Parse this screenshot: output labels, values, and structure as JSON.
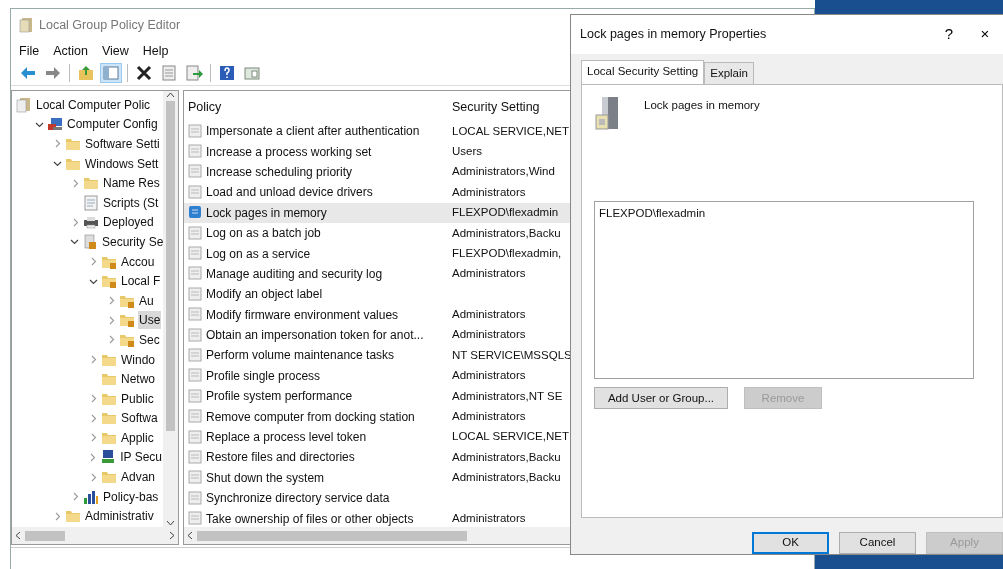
{
  "window": {
    "title": "Local Group Policy Editor"
  },
  "menu": [
    "File",
    "Action",
    "View",
    "Help"
  ],
  "toolbar": [
    {
      "kind": "back",
      "pressed": false
    },
    {
      "kind": "forward",
      "pressed": false
    },
    {
      "kind": "up",
      "pressed": false
    },
    {
      "kind": "tree",
      "pressed": true
    },
    {
      "kind": "delete",
      "pressed": false
    },
    {
      "kind": "properties",
      "pressed": false
    },
    {
      "kind": "export",
      "pressed": false
    },
    {
      "kind": "help",
      "pressed": false
    },
    {
      "kind": "view",
      "pressed": false
    }
  ],
  "tree": [
    {
      "label": "Local Computer Polic",
      "kind": "policy",
      "selected": false,
      "children": [
        {
          "label": "Computer Config",
          "kind": "computer",
          "expanded": true,
          "selected": false,
          "children": [
            {
              "label": "Software Setti",
              "kind": "folder",
              "expanded": false,
              "selected": false
            },
            {
              "label": "Windows Sett",
              "kind": "folder",
              "expanded": true,
              "selected": false,
              "children": [
                {
                  "label": "Name Res",
                  "kind": "folder",
                  "expanded": false,
                  "selected": false
                },
                {
                  "label": "Scripts (St",
                  "kind": "script",
                  "selected": false
                },
                {
                  "label": "Deployed",
                  "kind": "printer",
                  "expanded": false,
                  "selected": false
                },
                {
                  "label": "Security Se",
                  "kind": "security",
                  "expanded": true,
                  "selected": false,
                  "children": [
                    {
                      "label": "Accou",
                      "kind": "lockfolder",
                      "expanded": false,
                      "selected": false
                    },
                    {
                      "label": "Local F",
                      "kind": "lockfolder",
                      "expanded": true,
                      "selected": false,
                      "children": [
                        {
                          "label": "Au",
                          "kind": "lockfolder",
                          "expanded": false,
                          "selected": false
                        },
                        {
                          "label": "Use",
                          "kind": "lockfolder",
                          "expanded": false,
                          "selected": true
                        },
                        {
                          "label": "Sec",
                          "kind": "lockfolder",
                          "expanded": false,
                          "selected": false
                        }
                      ]
                    },
                    {
                      "label": "Windo",
                      "kind": "folder",
                      "expanded": false,
                      "selected": false
                    },
                    {
                      "label": "Netwo",
                      "kind": "folder",
                      "selected": false
                    },
                    {
                      "label": "Public",
                      "kind": "folder",
                      "expanded": false,
                      "selected": false
                    },
                    {
                      "label": "Softwa",
                      "kind": "folder",
                      "expanded": false,
                      "selected": false
                    },
                    {
                      "label": "Applic",
                      "kind": "folder",
                      "expanded": false,
                      "selected": false
                    },
                    {
                      "label": "IP Secu",
                      "kind": "network",
                      "expanded": false,
                      "selected": false
                    },
                    {
                      "label": "Advan",
                      "kind": "folder",
                      "expanded": false,
                      "selected": false
                    }
                  ]
                },
                {
                  "label": "Policy-bas",
                  "kind": "chart",
                  "expanded": false,
                  "selected": false
                }
              ]
            },
            {
              "label": "Administrativ",
              "kind": "folder",
              "expanded": false,
              "selected": false
            }
          ]
        }
      ]
    }
  ],
  "table": {
    "columns": [
      "Policy",
      "Security Setting"
    ],
    "rows": [
      {
        "policy": "Impersonate a client after authentication",
        "setting": "LOCAL SERVICE,NET",
        "selected": false
      },
      {
        "policy": "Increase a process working set",
        "setting": "Users",
        "selected": false
      },
      {
        "policy": "Increase scheduling priority",
        "setting": "Administrators,Wind",
        "selected": false
      },
      {
        "policy": "Load and unload device drivers",
        "setting": "Administrators",
        "selected": false
      },
      {
        "policy": "Lock pages in memory",
        "setting": "FLEXPOD\\flexadmin",
        "selected": true
      },
      {
        "policy": "Log on as a batch job",
        "setting": "Administrators,Backu",
        "selected": false
      },
      {
        "policy": "Log on as a service",
        "setting": "FLEXPOD\\flexadmin,",
        "selected": false
      },
      {
        "policy": "Manage auditing and security log",
        "setting": "Administrators",
        "selected": false
      },
      {
        "policy": "Modify an object label",
        "selected": false
      },
      {
        "policy": "Modify firmware environment values",
        "setting": "Administrators",
        "selected": false
      },
      {
        "policy": "Obtain an impersonation token for anot...",
        "setting": "Administrators",
        "selected": false
      },
      {
        "policy": "Perform volume maintenance tasks",
        "setting": "NT SERVICE\\MSSQLS",
        "selected": false
      },
      {
        "policy": "Profile single process",
        "setting": "Administrators",
        "selected": false
      },
      {
        "policy": "Profile system performance",
        "setting": "Administrators,NT SE",
        "selected": false
      },
      {
        "policy": "Remove computer from docking station",
        "setting": "Administrators",
        "selected": false
      },
      {
        "policy": "Replace a process level token",
        "setting": "LOCAL SERVICE,NET",
        "selected": false
      },
      {
        "policy": "Restore files and directories",
        "setting": "Administrators,Backu",
        "selected": false
      },
      {
        "policy": "Shut down the system",
        "setting": "Administrators,Backu",
        "selected": false
      },
      {
        "policy": "Synchronize directory service data",
        "selected": false
      },
      {
        "policy": "Take ownership of files or other objects",
        "setting": "Administrators",
        "selected": false
      }
    ]
  },
  "dialog": {
    "title": "Lock pages in memory Properties",
    "help_button": "?",
    "close_button": "×",
    "tabs": [
      {
        "label": "Local Security Setting",
        "selected": true
      },
      {
        "label": "Explain",
        "selected": false
      }
    ],
    "policy_name": "Lock pages in memory",
    "members": [
      {
        "label": "FLEXPOD\\flexadmin",
        "selected": false
      }
    ],
    "buttons": [
      {
        "label": "Add User or Group...",
        "disabled": false
      },
      {
        "label": "Remove",
        "disabled": true
      }
    ],
    "footer_buttons": [
      {
        "label": "OK",
        "disabled": false,
        "default": true
      },
      {
        "label": "Cancel",
        "disabled": false,
        "default": false
      },
      {
        "label": "Apply",
        "disabled": true,
        "default": false
      }
    ]
  }
}
